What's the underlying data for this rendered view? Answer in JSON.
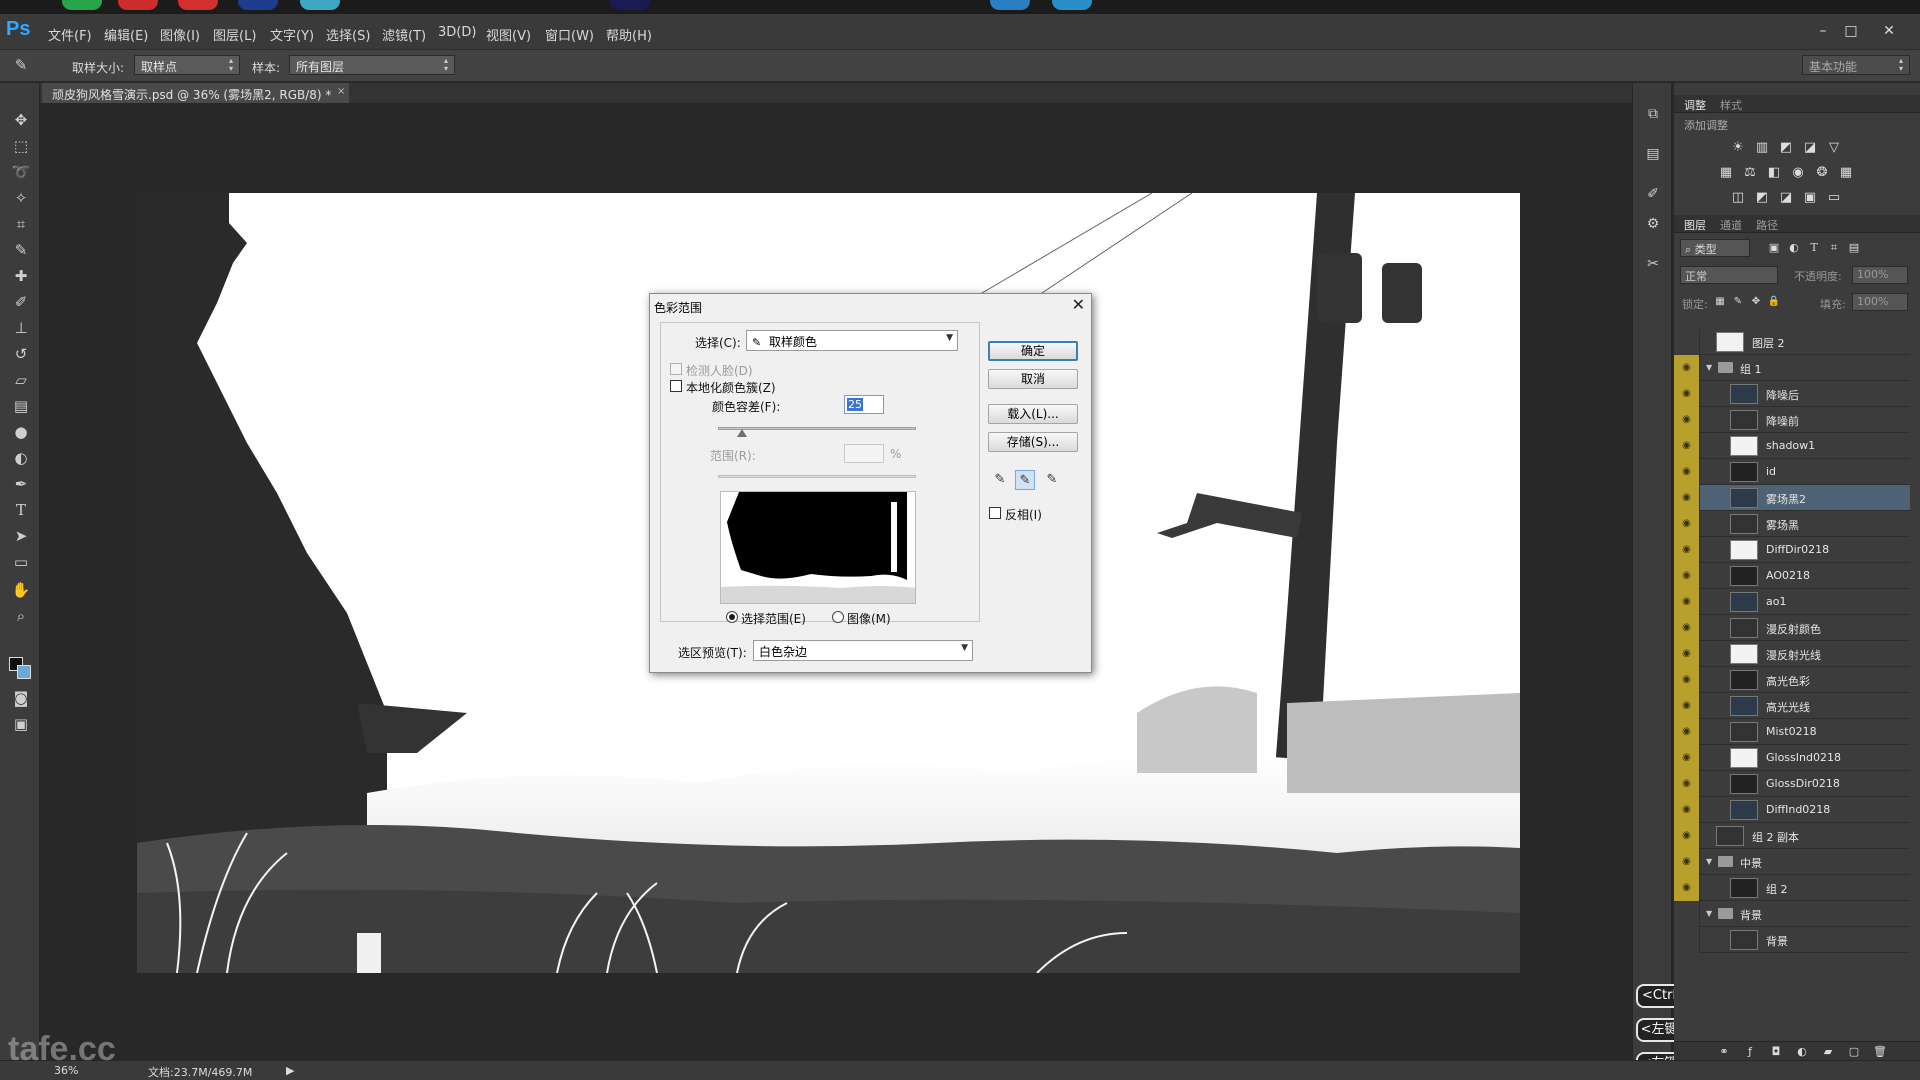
{
  "menubar": {
    "logo": "Ps",
    "items": [
      "文件(F)",
      "编辑(E)",
      "图像(I)",
      "图层(L)",
      "文字(Y)",
      "选择(S)",
      "滤镜(T)",
      "3D(D)",
      "视图(V)",
      "窗口(W)",
      "帮助(H)"
    ],
    "window_controls": [
      "–",
      "□",
      "✕"
    ]
  },
  "options": {
    "sample_size_label": "取样大小:",
    "sample_size_value": "取样点",
    "sample_label": "样本:",
    "sample_value": "所有图层",
    "workspace": "基本功能"
  },
  "document": {
    "tab_title": "顽皮狗风格雪演示.psd @ 36% (雾场黑2, RGB/8) *",
    "close": "×"
  },
  "dialog": {
    "title": "色彩范围",
    "close": "✕",
    "select_label": "选择(C):",
    "select_value": "取样颜色",
    "detect_faces": "检测人脸(D)",
    "localized_clusters": "本地化颜色簇(Z)",
    "fuzziness_label": "颜色容差(F):",
    "fuzziness_value": "25",
    "fuzziness_fraction": 0.12,
    "range_label": "范围(R):",
    "range_unit": "%",
    "radio_selection": "选择范围(E)",
    "radio_image": "图像(M)",
    "preview_label": "选区预览(T):",
    "preview_value": "白色杂边",
    "buttons": {
      "ok": "确定",
      "cancel": "取消",
      "load": "载入(L)...",
      "save": "存储(S)..."
    },
    "invert_label": "反相(I)"
  },
  "panels": {
    "adjust_tabs": [
      "调整",
      "样式"
    ],
    "adjust_title": "添加调整",
    "layers_tabs": [
      "图层",
      "通道",
      "路径"
    ],
    "filter_kind": "类型",
    "blend_mode": "正常",
    "opacity_label": "不透明度:",
    "opacity_value": "100%",
    "lock_label": "锁定:",
    "fill_label": "填充:",
    "fill_value": "100%"
  },
  "layers": [
    {
      "name": "图层 2",
      "indent": 0,
      "type": "layer",
      "eye": false
    },
    {
      "name": "组 1",
      "indent": 0,
      "type": "group",
      "eye": true
    },
    {
      "name": "降噪后",
      "indent": 1,
      "type": "layer",
      "eye": true
    },
    {
      "name": "降噪前",
      "indent": 1,
      "type": "layer",
      "eye": true
    },
    {
      "name": "shadow1",
      "indent": 1,
      "type": "layer",
      "eye": true
    },
    {
      "name": "id",
      "indent": 1,
      "type": "layer",
      "eye": true
    },
    {
      "name": "雾场黑2",
      "indent": 1,
      "type": "layer",
      "eye": true,
      "selected": true
    },
    {
      "name": "雾场黑",
      "indent": 1,
      "type": "layer",
      "eye": true
    },
    {
      "name": "DiffDir0218",
      "indent": 1,
      "type": "layer",
      "eye": true
    },
    {
      "name": "AO0218",
      "indent": 1,
      "type": "layer",
      "eye": true
    },
    {
      "name": "ao1",
      "indent": 1,
      "type": "layer",
      "eye": true
    },
    {
      "name": "漫反射颜色",
      "indent": 1,
      "type": "layer",
      "eye": true
    },
    {
      "name": "漫反射光线",
      "indent": 1,
      "type": "layer",
      "eye": true
    },
    {
      "name": "高光色彩",
      "indent": 1,
      "type": "layer",
      "eye": true
    },
    {
      "name": "高光光线",
      "indent": 1,
      "type": "layer",
      "eye": true
    },
    {
      "name": "Mist0218",
      "indent": 1,
      "type": "layer",
      "eye": true
    },
    {
      "name": "GlossInd0218",
      "indent": 1,
      "type": "layer",
      "eye": true
    },
    {
      "name": "GlossDir0218",
      "indent": 1,
      "type": "layer",
      "eye": true
    },
    {
      "name": "DiffInd0218",
      "indent": 1,
      "type": "layer",
      "eye": true
    },
    {
      "name": "组 2 副本",
      "indent": 0,
      "type": "layer",
      "eye": true
    },
    {
      "name": "中景",
      "indent": 0,
      "type": "group",
      "eye": true
    },
    {
      "name": "组 2",
      "indent": 1,
      "type": "layer",
      "eye": true
    },
    {
      "name": "背景",
      "indent": 0,
      "type": "group",
      "eye": false
    },
    {
      "name": "背景",
      "indent": 1,
      "type": "layer",
      "eye": false
    }
  ],
  "key_badges": [
    "<Ctrl>",
    "<左键>",
    "<左键>"
  ],
  "status": {
    "zoom": "36%",
    "doc": "文档:23.7M/469.7M",
    "watermark": "tafe.cc"
  },
  "colors": {
    "layer_visible_bg": "#b8a02c",
    "selected_row": "#4f6175",
    "accent": "#31a8ff"
  }
}
